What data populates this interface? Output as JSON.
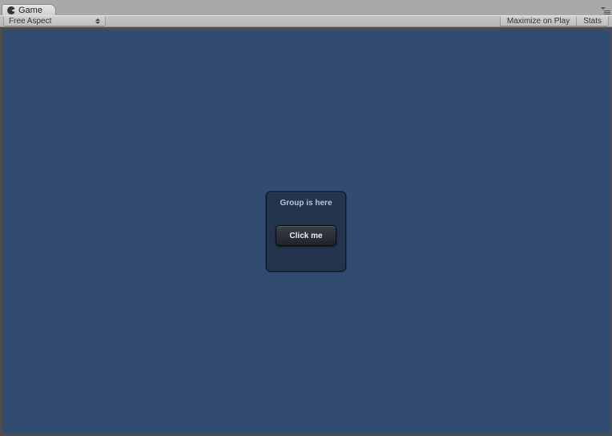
{
  "tab": {
    "label": "Game"
  },
  "toolbar": {
    "aspect_label": "Free Aspect",
    "maximize_label": "Maximize on Play",
    "stats_label": "Stats"
  },
  "scene": {
    "group_title": "Group is here",
    "button_label": "Click me"
  },
  "colors": {
    "viewport_bg": "#324b71"
  }
}
